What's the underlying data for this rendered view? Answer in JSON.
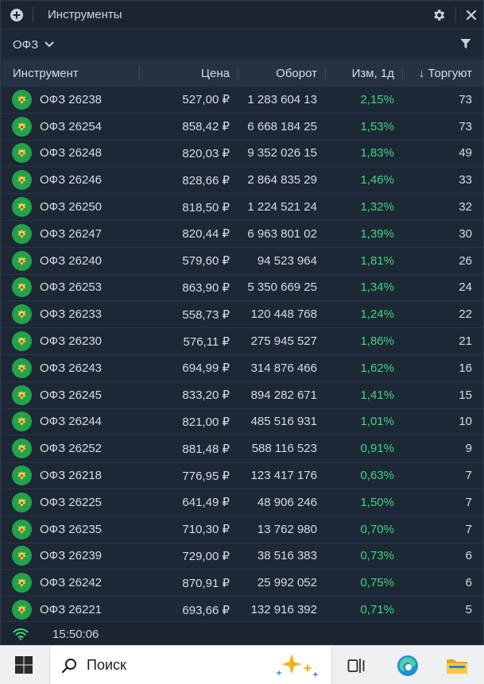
{
  "window": {
    "title": "Инструменты",
    "add_icon": "plus-circle-icon",
    "settings_icon": "gear-icon",
    "close_icon": "close-icon"
  },
  "filter": {
    "selected": "ОФЗ",
    "dropdown_icon": "chevron-down-icon",
    "filter_icon": "funnel-icon"
  },
  "table": {
    "columns": {
      "name": "Инструмент",
      "price": "Цена",
      "turnover": "Оборот",
      "change": "Изм, 1д",
      "trading": "↓ Торгуют"
    },
    "rows": [
      {
        "name": "ОФЗ 26238",
        "price": "527,00 ₽",
        "turnover": "1 283 604 13",
        "change": "2,15%",
        "trading": "73"
      },
      {
        "name": "ОФЗ 26254",
        "price": "858,42 ₽",
        "turnover": "6 668 184 25",
        "change": "1,53%",
        "trading": "73"
      },
      {
        "name": "ОФЗ 26248",
        "price": "820,03 ₽",
        "turnover": "9 352 026 15",
        "change": "1,83%",
        "trading": "49"
      },
      {
        "name": "ОФЗ 26246",
        "price": "828,66 ₽",
        "turnover": "2 864 835 29",
        "change": "1,46%",
        "trading": "33"
      },
      {
        "name": "ОФЗ 26250",
        "price": "818,50 ₽",
        "turnover": "1 224 521 24",
        "change": "1,32%",
        "trading": "32"
      },
      {
        "name": "ОФЗ 26247",
        "price": "820,44 ₽",
        "turnover": "6 963 801 02",
        "change": "1,39%",
        "trading": "30"
      },
      {
        "name": "ОФЗ 26240",
        "price": "579,60 ₽",
        "turnover": "94 523 964",
        "change": "1,81%",
        "trading": "26"
      },
      {
        "name": "ОФЗ 26253",
        "price": "863,90 ₽",
        "turnover": "5 350 669 25",
        "change": "1,34%",
        "trading": "24"
      },
      {
        "name": "ОФЗ 26233",
        "price": "558,73 ₽",
        "turnover": "120 448 768",
        "change": "1,24%",
        "trading": "22"
      },
      {
        "name": "ОФЗ 26230",
        "price": "576,11 ₽",
        "turnover": "275 945 527",
        "change": "1,86%",
        "trading": "21"
      },
      {
        "name": "ОФЗ 26243",
        "price": "694,99 ₽",
        "turnover": "314 876 466",
        "change": "1,62%",
        "trading": "16"
      },
      {
        "name": "ОФЗ 26245",
        "price": "833,20 ₽",
        "turnover": "894 282 671",
        "change": "1,41%",
        "trading": "15"
      },
      {
        "name": "ОФЗ 26244",
        "price": "821,00 ₽",
        "turnover": "485 516 931",
        "change": "1,01%",
        "trading": "10"
      },
      {
        "name": "ОФЗ 26252",
        "price": "881,48 ₽",
        "turnover": "588 116 523",
        "change": "0,91%",
        "trading": "9"
      },
      {
        "name": "ОФЗ 26218",
        "price": "776,95 ₽",
        "turnover": "123 417 176",
        "change": "0,63%",
        "trading": "7"
      },
      {
        "name": "ОФЗ 26225",
        "price": "641,49 ₽",
        "turnover": "48 906 246",
        "change": "1,50%",
        "trading": "7"
      },
      {
        "name": "ОФЗ 26235",
        "price": "710,30 ₽",
        "turnover": "13 762 980",
        "change": "0,70%",
        "trading": "7"
      },
      {
        "name": "ОФЗ 26239",
        "price": "729,00 ₽",
        "turnover": "38 516 383",
        "change": "0,73%",
        "trading": "6"
      },
      {
        "name": "ОФЗ 26242",
        "price": "870,91 ₽",
        "turnover": "25 992 052",
        "change": "0,75%",
        "trading": "6"
      },
      {
        "name": "ОФЗ 26221",
        "price": "693,66 ₽",
        "turnover": "132 916 392",
        "change": "0,71%",
        "trading": "5"
      }
    ]
  },
  "status": {
    "time": "15:50:06",
    "connection_icon": "wifi-icon"
  },
  "taskbar": {
    "search_label": "Поиск"
  },
  "colors": {
    "positive": "#3ed77a",
    "emblem": "#23a24a",
    "background": "#1d2836"
  }
}
